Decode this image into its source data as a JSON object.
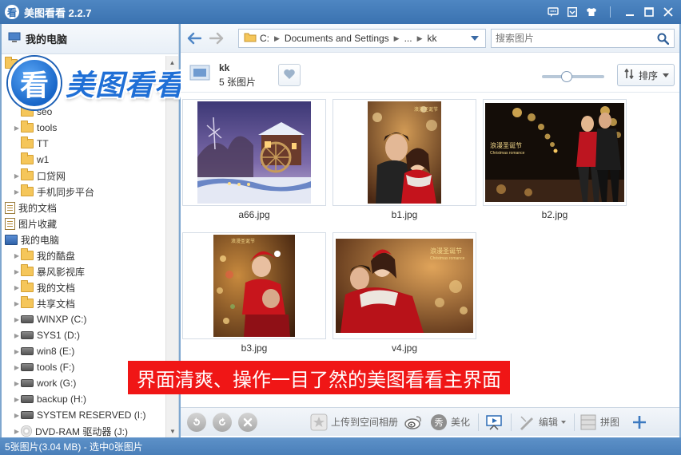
{
  "app": {
    "title": "美图看看 2.2.7",
    "logo_text": "看",
    "brand_text": "美图看看"
  },
  "sidebar": {
    "header": "我的电脑",
    "items": [
      {
        "label": "seo",
        "icon": "folder",
        "indent": 1,
        "arrow": false
      },
      {
        "label": "tools",
        "icon": "folder",
        "indent": 1,
        "arrow": true
      },
      {
        "label": "TT",
        "icon": "folder",
        "indent": 1,
        "arrow": false
      },
      {
        "label": "w1",
        "icon": "folder",
        "indent": 1,
        "arrow": false
      },
      {
        "label": "口贷网",
        "icon": "folder",
        "indent": 1,
        "arrow": true
      },
      {
        "label": "手机同步平台",
        "icon": "folder",
        "indent": 1,
        "arrow": true
      },
      {
        "label": "我的文档",
        "icon": "doc",
        "indent": 0,
        "arrow": false
      },
      {
        "label": "图片收藏",
        "icon": "doc",
        "indent": 0,
        "arrow": false
      },
      {
        "label": "我的电脑",
        "icon": "pc",
        "indent": 0,
        "arrow": false
      },
      {
        "label": "我的酷盘",
        "icon": "folder",
        "indent": 1,
        "arrow": true
      },
      {
        "label": "暴风影视库",
        "icon": "folder",
        "indent": 1,
        "arrow": true
      },
      {
        "label": "我的文档",
        "icon": "folder",
        "indent": 1,
        "arrow": true
      },
      {
        "label": "共享文档",
        "icon": "folder",
        "indent": 1,
        "arrow": true
      },
      {
        "label": "WINXP (C:)",
        "icon": "drive",
        "indent": 1,
        "arrow": true
      },
      {
        "label": "SYS1 (D:)",
        "icon": "drive",
        "indent": 1,
        "arrow": true
      },
      {
        "label": "win8 (E:)",
        "icon": "drive",
        "indent": 1,
        "arrow": true
      },
      {
        "label": "tools (F:)",
        "icon": "drive",
        "indent": 1,
        "arrow": true
      },
      {
        "label": "work (G:)",
        "icon": "drive",
        "indent": 1,
        "arrow": true
      },
      {
        "label": "backup (H:)",
        "icon": "drive",
        "indent": 1,
        "arrow": true
      },
      {
        "label": "SYSTEM RESERVED (I:)",
        "icon": "drive",
        "indent": 1,
        "arrow": true
      },
      {
        "label": "DVD-RAM 驱动器 (J:)",
        "icon": "cd",
        "indent": 1,
        "arrow": true
      }
    ]
  },
  "nav": {
    "path_drive": "C:",
    "path_seg1": "Documents and Settings",
    "path_ellipsis": "...",
    "path_current": "kk",
    "search_placeholder": "搜索图片"
  },
  "folder": {
    "name": "kk",
    "count": "5 张图片",
    "sort_label": "排序"
  },
  "images": [
    {
      "name": "a66.jpg",
      "type": "winter"
    },
    {
      "name": "b1.jpg",
      "type": "couple1"
    },
    {
      "name": "b2.jpg",
      "type": "couple2"
    },
    {
      "name": "b3.jpg",
      "type": "couple3"
    },
    {
      "name": "v4.jpg",
      "type": "couple4"
    }
  ],
  "image_overlay_text": {
    "line1": "浪漫圣诞节",
    "line2": "Christmas romance"
  },
  "caption": "界面清爽、操作一目了然的美图看看主界面",
  "toolbar": {
    "upload": "上传到空间相册",
    "beautify": "美化",
    "edit": "编辑",
    "collage": "拼图"
  },
  "status": "5张图片(3.04 MB) - 选中0张图片"
}
